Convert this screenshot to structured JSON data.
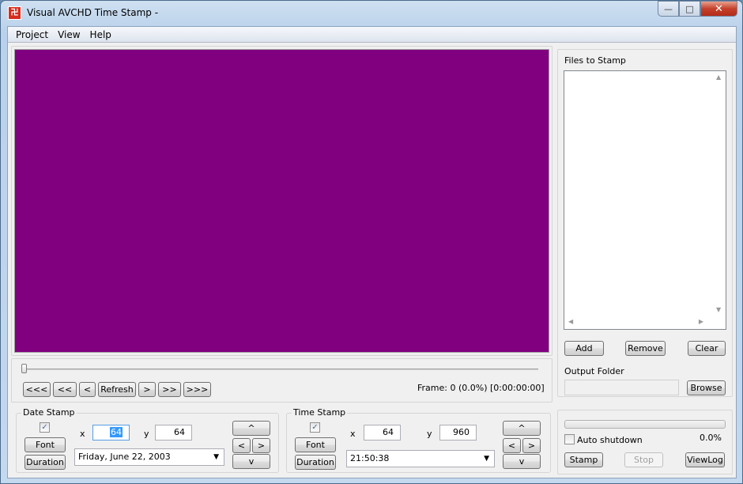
{
  "window": {
    "title": "Visual AVCHD Time Stamp -",
    "app_icon": "app-logo-icon",
    "controls": {
      "minimize": "—",
      "maximize": "□",
      "close": "✕"
    }
  },
  "menu": [
    "Project",
    "View",
    "Help"
  ],
  "preview": {
    "color": "#800080"
  },
  "navigation": {
    "buttons": [
      "<<<",
      "<<",
      "<",
      "Refresh",
      ">",
      ">>",
      ">>>"
    ],
    "frame_status": "Frame: 0 (0.0%) [0:00:00:00]",
    "slider_position": 0
  },
  "files": {
    "label": "Files to Stamp",
    "items": [],
    "add": "Add",
    "remove": "Remove",
    "clear": "Clear",
    "output_label": "Output Folder",
    "output_value": "",
    "browse": "Browse"
  },
  "date_stamp": {
    "title": "Date Stamp",
    "enabled": true,
    "font": "Font",
    "duration": "Duration",
    "x_label": "x",
    "x_value": "64",
    "y_label": "y",
    "y_value": "64",
    "format": "Friday, June 22, 2003",
    "up": "^",
    "left": "<",
    "right": ">",
    "down": "v"
  },
  "time_stamp": {
    "title": "Time Stamp",
    "enabled": true,
    "font": "Font",
    "duration": "Duration",
    "x_label": "x",
    "x_value": "64",
    "y_label": "y",
    "y_value": "960",
    "format": "21:50:38",
    "up": "^",
    "left": "<",
    "right": ">",
    "down": "v"
  },
  "process": {
    "progress_percent": 0.0,
    "progress_text": "0.0%",
    "auto_shutdown_label": "Auto shutdown",
    "auto_shutdown": false,
    "stamp": "Stamp",
    "stop": "Stop",
    "viewlog": "ViewLog"
  }
}
